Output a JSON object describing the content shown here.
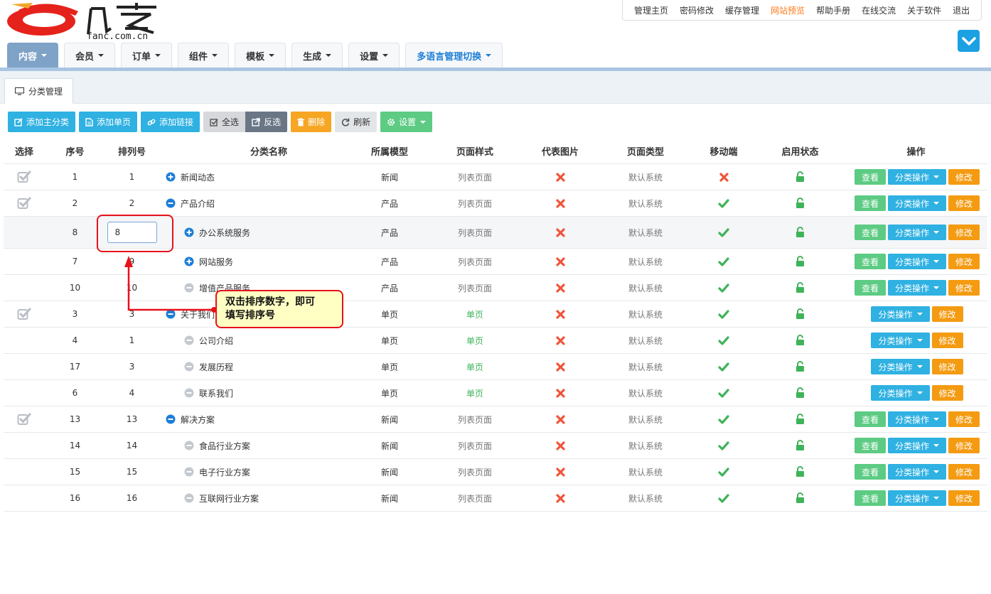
{
  "header": {
    "logo_text": "fanc.com.cn",
    "logo_chars": "凡客"
  },
  "topnav": [
    "管理主页",
    "密码修改",
    "缓存管理",
    "网站预览",
    "帮助手册",
    "在线交流",
    "关于软件",
    "退出"
  ],
  "mainnav": [
    "内容",
    "会员",
    "订单",
    "组件",
    "模板",
    "生成",
    "设置",
    "多语言管理切换"
  ],
  "subtab": "分类管理",
  "toolbar": {
    "add_main": "添加主分类",
    "add_page": "添加单页",
    "add_link": "添加链接",
    "select_all": "全选",
    "invert": "反选",
    "delete": "删除",
    "refresh": "刷新",
    "settings": "设置"
  },
  "columns": [
    "选择",
    "序号",
    "排列号",
    "分类名称",
    "所属模型",
    "页面样式",
    "代表图片",
    "页面类型",
    "移动端",
    "启用状态",
    "操作"
  ],
  "rows": [
    {
      "idx": "1",
      "ord": "1",
      "name": "新闻动态",
      "model": "新闻",
      "style": "列表页面",
      "type": "默认系统"
    },
    {
      "idx": "2",
      "ord": "2",
      "name": "产品介绍",
      "model": "产品",
      "style": "列表页面",
      "type": "默认系统"
    },
    {
      "idx": "8",
      "ord": "8",
      "name": "办公系统服务",
      "model": "产品",
      "style": "列表页面",
      "type": "默认系统"
    },
    {
      "idx": "7",
      "ord": "9",
      "name": "网站服务",
      "model": "产品",
      "style": "列表页面",
      "type": "默认系统"
    },
    {
      "idx": "10",
      "ord": "10",
      "name": "增值产品服务",
      "model": "产品",
      "style": "列表页面",
      "type": "默认系统"
    },
    {
      "idx": "3",
      "ord": "3",
      "name": "关于我们",
      "model": "单页",
      "style": "单页",
      "type": "默认系统"
    },
    {
      "idx": "4",
      "ord": "1",
      "name": "公司介绍",
      "model": "单页",
      "style": "单页",
      "type": "默认系统"
    },
    {
      "idx": "17",
      "ord": "3",
      "name": "发展历程",
      "model": "单页",
      "style": "单页",
      "type": "默认系统"
    },
    {
      "idx": "6",
      "ord": "4",
      "name": "联系我们",
      "model": "单页",
      "style": "单页",
      "type": "默认系统"
    },
    {
      "idx": "13",
      "ord": "13",
      "name": "解决方案",
      "model": "新闻",
      "style": "列表页面",
      "type": "默认系统"
    },
    {
      "idx": "14",
      "ord": "14",
      "name": "食品行业方案",
      "model": "新闻",
      "style": "列表页面",
      "type": "默认系统"
    },
    {
      "idx": "15",
      "ord": "15",
      "name": "电子行业方案",
      "model": "新闻",
      "style": "列表页面",
      "type": "默认系统"
    },
    {
      "idx": "16",
      "ord": "16",
      "name": "互联网行业方案",
      "model": "新闻",
      "style": "列表页面",
      "type": "默认系统"
    }
  ],
  "ops": {
    "view": "查看",
    "category": "分类操作",
    "edit": "修改"
  },
  "callout_line1": "双击排序数字，即可",
  "callout_line2": "填写排序号",
  "colors": {
    "accent": "#2fb1e2",
    "active_nav": "#7fa2c7",
    "preview_link": "#ff7a18",
    "red_mark": "#e8111a"
  }
}
